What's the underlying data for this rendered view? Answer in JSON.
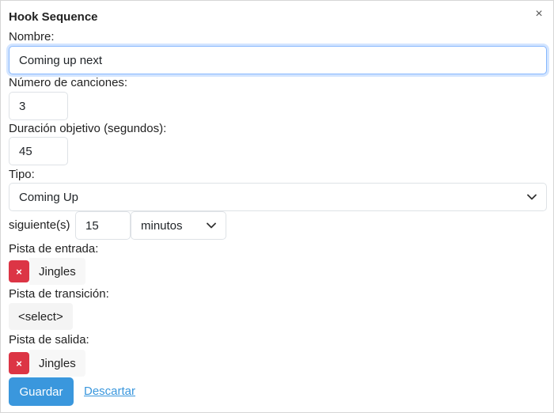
{
  "dialog": {
    "title": "Hook Sequence",
    "close_glyph": "×"
  },
  "form": {
    "name_label": "Nombre:",
    "name_value": "Coming up next",
    "songs_label": "Número de canciones:",
    "songs_value": "3",
    "duration_label": "Duración objetivo (segundos):",
    "duration_value": "45",
    "type_label": "Tipo:",
    "type_value": "Coming Up",
    "next_prefix": "siguiente(s)",
    "next_amount": "15",
    "next_unit": "minutos",
    "intro_label": "Pista de entrada:",
    "intro_track": "Jingles",
    "transition_label": "Pista de transición:",
    "transition_select": "<select>",
    "outro_label": "Pista de salida:",
    "outro_track": "Jingles",
    "remove_glyph": "×"
  },
  "actions": {
    "save_label": "Guardar",
    "discard_label": "Descartar"
  },
  "colors": {
    "accent": "#3a97dd",
    "danger": "#dc3545",
    "focus_border": "#86b7fe"
  },
  "icons": {
    "close": "close-icon",
    "dropdown": "chevron-down-icon",
    "remove": "remove-icon"
  }
}
